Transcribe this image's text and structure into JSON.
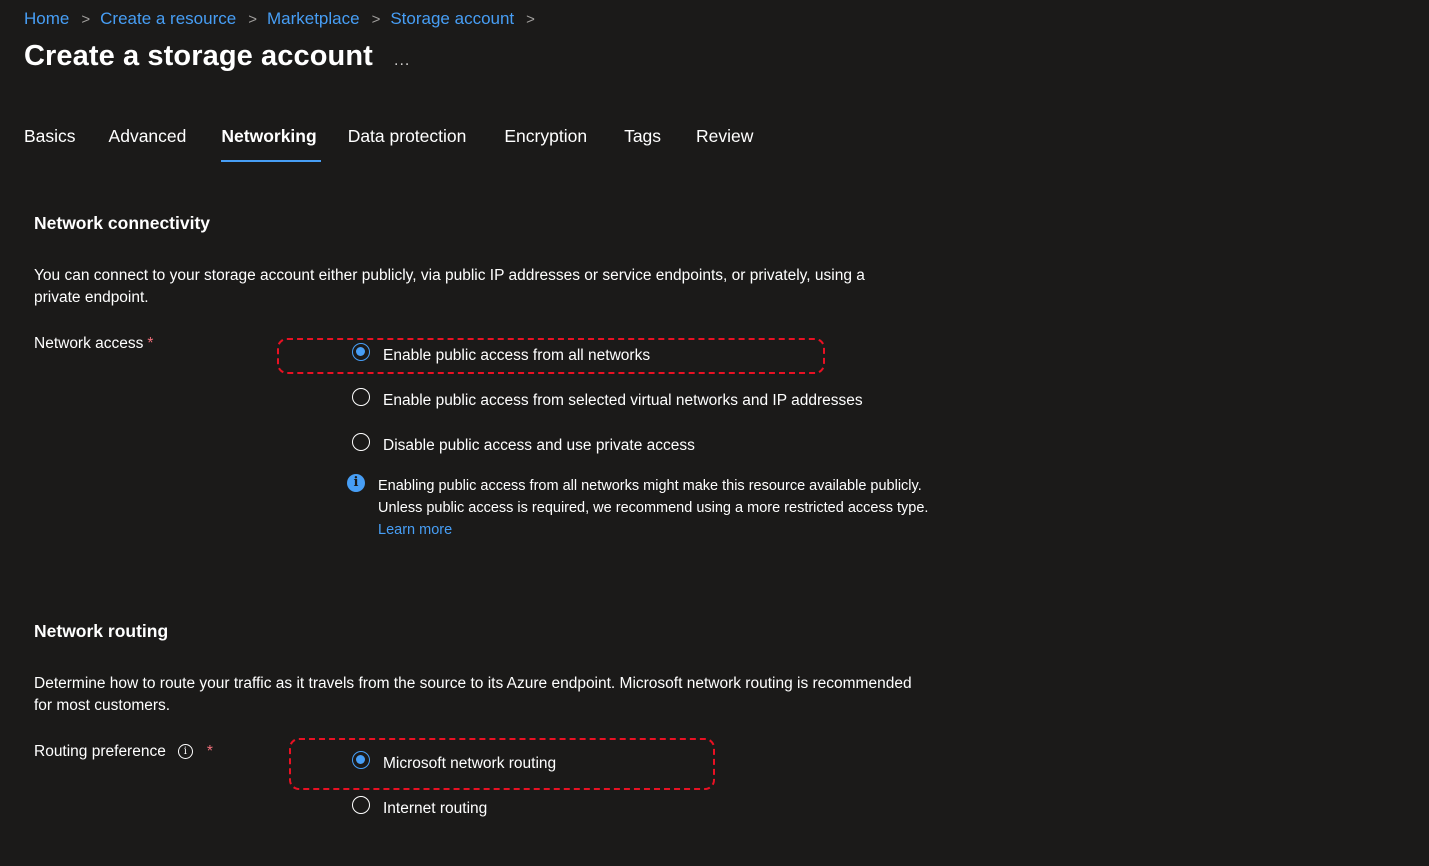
{
  "breadcrumb": [
    "Home",
    "Create a resource",
    "Marketplace",
    "Storage account"
  ],
  "breadcrumb_separator": ">",
  "page_title": "Create a storage account",
  "more_label": "...",
  "tabs": [
    {
      "label": "Basics"
    },
    {
      "label": "Advanced"
    },
    {
      "label": "Networking",
      "active": true
    },
    {
      "label": "Data protection"
    },
    {
      "label": "Encryption"
    },
    {
      "label": "Tags"
    },
    {
      "label": "Review"
    }
  ],
  "connectivity": {
    "title": "Network connectivity",
    "description": "You can connect to your storage account either publicly, via public IP addresses or service endpoints, or privately, using a private endpoint.",
    "field_label": "Network access",
    "required_marker": "*",
    "options": [
      {
        "label": "Enable public access from all networks",
        "selected": true
      },
      {
        "label": "Enable public access from selected virtual networks and IP addresses",
        "selected": false
      },
      {
        "label": "Disable public access and use private access",
        "selected": false
      }
    ],
    "info_icon": "info-icon",
    "info_text": "Enabling public access from all networks might make this resource available publicly. Unless public access is required, we recommend using a more restricted access type.",
    "learn_more": "Learn more"
  },
  "routing": {
    "title": "Network routing",
    "description": "Determine how to route your traffic as it travels from the source to its Azure endpoint. Microsoft network routing is recommended for most customers.",
    "field_label": "Routing preference",
    "info_glyph": "i",
    "required_marker": "*",
    "options": [
      {
        "label": "Microsoft network routing",
        "selected": true
      },
      {
        "label": "Internet routing",
        "selected": false
      }
    ]
  },
  "colors": {
    "background": "#1b1a19",
    "accent": "#479ef5",
    "required": "#f1707b",
    "highlight": "#e81123"
  }
}
